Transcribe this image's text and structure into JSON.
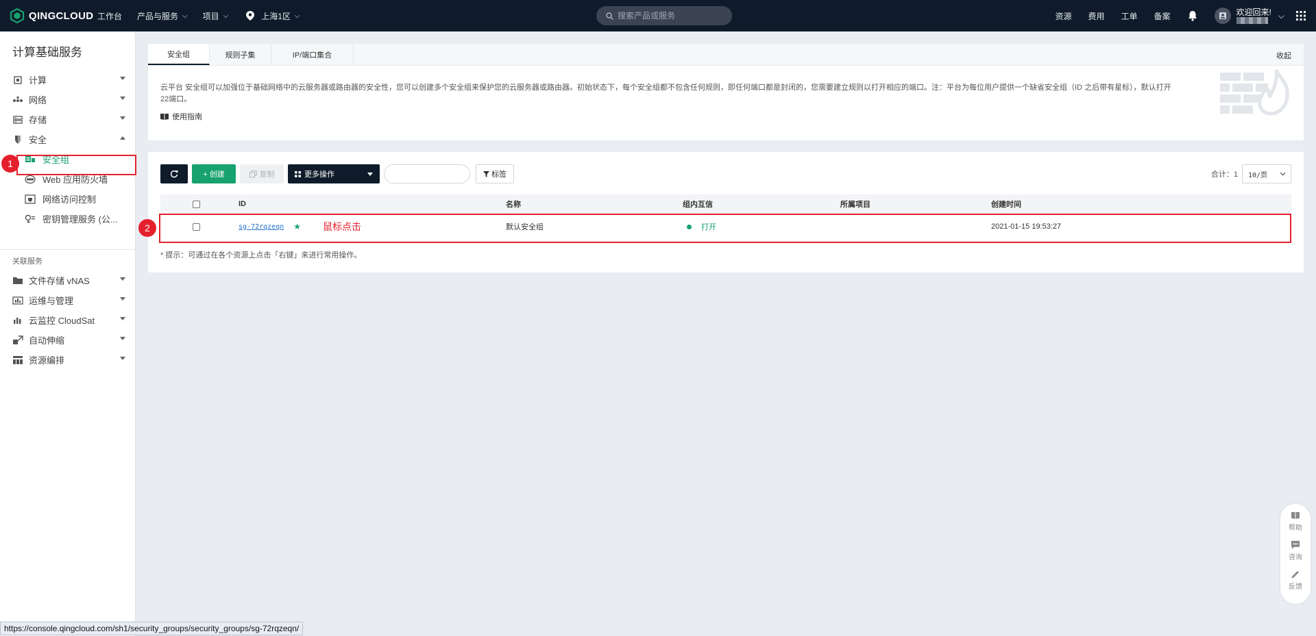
{
  "brand": {
    "name": "QINGCLOUD",
    "color": "#17a26f"
  },
  "topnav": {
    "workbench": "工作台",
    "products": "产品与服务",
    "project": "项目",
    "region": "上海1区"
  },
  "search": {
    "placeholder": "搜索产品或服务"
  },
  "top_right": {
    "resources": "资源",
    "billing": "费用",
    "tickets": "工单",
    "filing": "备案",
    "welcome": "欢迎回来!"
  },
  "sidebar": {
    "title": "计算基础服务",
    "items": [
      {
        "label": "计算"
      },
      {
        "label": "网络"
      },
      {
        "label": "存储"
      },
      {
        "label": "安全"
      }
    ],
    "security_subitems": [
      {
        "label": "安全组"
      },
      {
        "label": "Web 应用防火墙"
      },
      {
        "label": "网络访问控制"
      },
      {
        "label": "密钥管理服务 (公..."
      }
    ],
    "related_title": "关联服务",
    "related_items": [
      {
        "label": "文件存储 vNAS"
      },
      {
        "label": "运维与管理"
      },
      {
        "label": "云监控 CloudSat"
      },
      {
        "label": "自动伸缩"
      },
      {
        "label": "资源编排"
      }
    ]
  },
  "annotations": {
    "step1": "1",
    "step2": "2",
    "click_note": "鼠标点击"
  },
  "info_card": {
    "tabs": [
      "安全组",
      "规则子集",
      "IP/端口集合"
    ],
    "collapse": "收起",
    "intro": "云平台 安全组可以加强位于基础网络中的云服务器或路由器的安全性，您可以创建多个安全组来保护您的云服务器或路由器。初始状态下，每个安全组都不包含任何规则，即任何端口都是封闭的，您需要建立规则以打开相应的端口。注：平台为每位用户提供一个缺省安全组（ID 之后带有星标），默认打开22端口。",
    "guide": "使用指南"
  },
  "toolbar": {
    "create": "+ 创建",
    "copy": "复制",
    "more": "更多操作",
    "tag": "标签",
    "total": "合计：1",
    "page_size": "10/页"
  },
  "table": {
    "headers": {
      "id": "ID",
      "name": "名称",
      "mutual": "组内互信",
      "project": "所属项目",
      "created": "创建时间"
    },
    "rows": [
      {
        "id": "sg-72rqzeqn",
        "name": "默认安全组",
        "mutual": "打开",
        "project": "",
        "created": "2021-01-15 19:53:27"
      }
    ],
    "tip": "* 提示：可通过在各个资源上点击「右键」来进行常用操作。"
  },
  "float_tools": {
    "help": "帮助",
    "consult": "咨询",
    "feedback": "反馈"
  },
  "status_url": "https://console.qingcloud.com/sh1/security_groups/security_groups/sg-72rqzeqn/"
}
